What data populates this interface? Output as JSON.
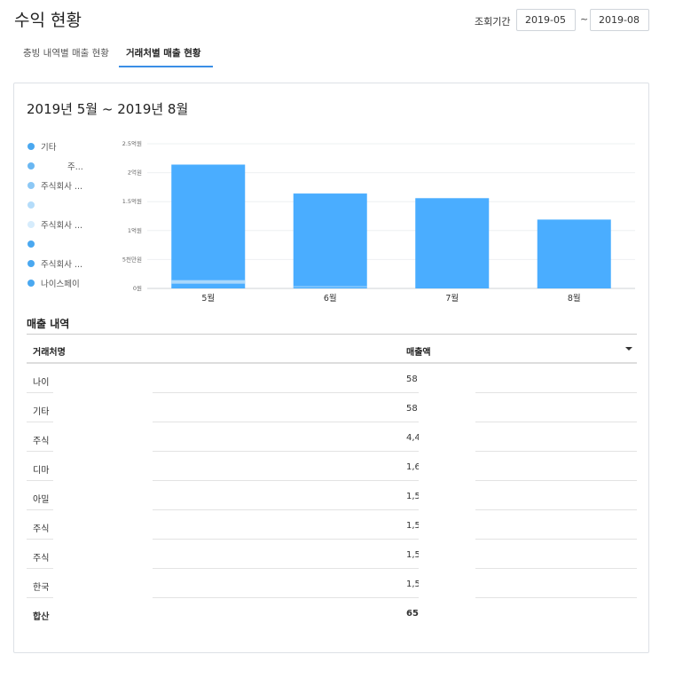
{
  "page": {
    "title": "수익 현황",
    "period_label": "조회기간",
    "date_from": "2019-05",
    "date_to": "2019-08",
    "tilde": "~"
  },
  "tabs": [
    {
      "label": "충빙 내역별 매출 현황",
      "active": false
    },
    {
      "label": "거래처별 매출 현황",
      "active": true
    }
  ],
  "card": {
    "range_title": "2019년 5월 ~ 2019년 8월"
  },
  "legend": [
    {
      "label": "기타",
      "color": "#4aa8f0"
    },
    {
      "label": "주...",
      "color": "#6ab7f2"
    },
    {
      "label": "주식회사 ...",
      "color": "#8cc8f5"
    },
    {
      "label": "",
      "color": "#b4dcfa"
    },
    {
      "label": "주식회사 ...",
      "color": "#d6ecfc"
    },
    {
      "label": "",
      "color": "#4aa8f0"
    },
    {
      "label": "주식회사 ...",
      "color": "#4aa8f0"
    },
    {
      "label": "나이스페이",
      "color": "#4aa8f0"
    }
  ],
  "chart_data": {
    "type": "bar",
    "categories": [
      "5월",
      "6월",
      "7월",
      "8월"
    ],
    "values": [
      214000000,
      164000000,
      156000000,
      119000000
    ],
    "ylim": [
      0,
      250000000
    ],
    "y_ticks": [
      {
        "value": 0,
        "label": "0원"
      },
      {
        "value": 50000000,
        "label": "5천만원"
      },
      {
        "value": 100000000,
        "label": "1억원"
      },
      {
        "value": 150000000,
        "label": "1.5억원"
      },
      {
        "value": 200000000,
        "label": "2억원"
      },
      {
        "value": 250000000,
        "label": "2.5억원"
      }
    ],
    "bar_color": "#4aadff",
    "grid": true
  },
  "table": {
    "section_title": "매출 내역",
    "headers": {
      "name": "거래처명",
      "amount": "매출액"
    },
    "rows": [
      {
        "name": "나이",
        "amount": "58"
      },
      {
        "name": "기타",
        "amount": "58"
      },
      {
        "name": "주식",
        "amount": "4,4"
      },
      {
        "name": "디마",
        "amount": "1,6"
      },
      {
        "name": "아밀",
        "amount": "1,5"
      },
      {
        "name": "주식",
        "amount": "1,5"
      },
      {
        "name": "주식",
        "amount": "1,5"
      },
      {
        "name": "한국",
        "amount": "1,5"
      }
    ],
    "total": {
      "name": "합산",
      "amount": "65"
    }
  }
}
